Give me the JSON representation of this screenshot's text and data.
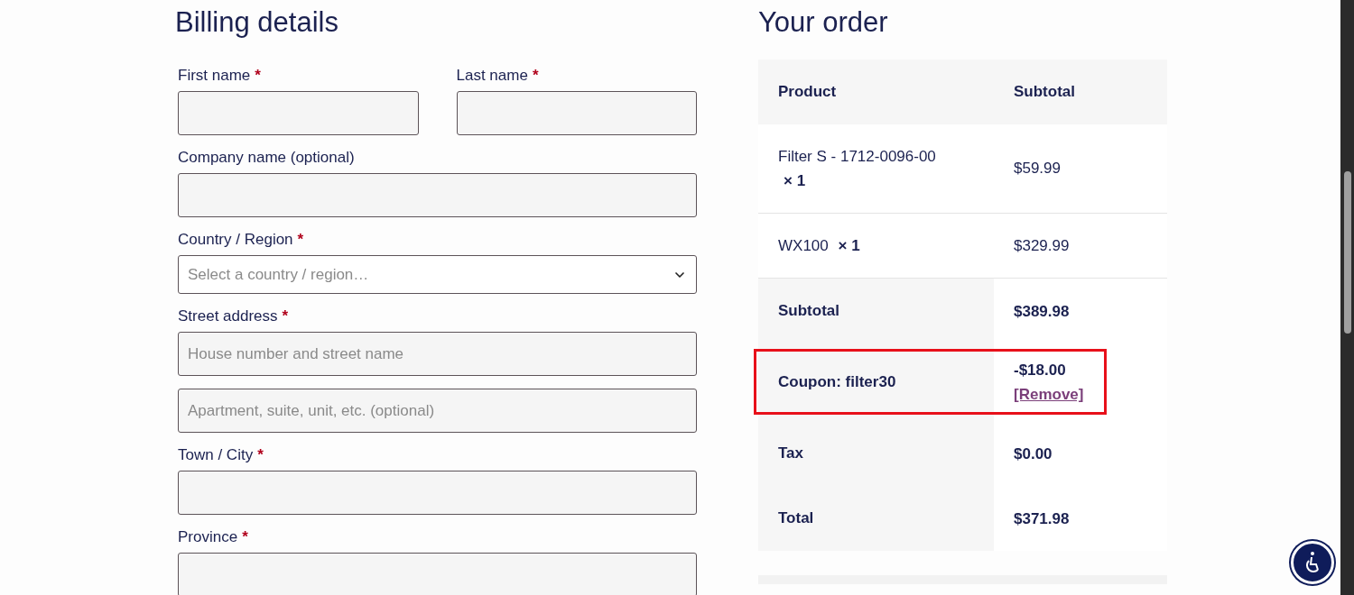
{
  "billing": {
    "title": "Billing details",
    "rows": [
      [
        {
          "label": "First name",
          "required_mark": "*",
          "kind": "input"
        },
        {
          "label": "Last name",
          "required_mark": "*",
          "kind": "input"
        }
      ],
      [
        {
          "label": "Company name (optional)",
          "kind": "input"
        }
      ],
      [
        {
          "label": "Country / Region",
          "required_mark": "*",
          "kind": "select",
          "placeholder": "Select a country / region…"
        }
      ],
      [
        {
          "label": "Street address",
          "required_mark": "*",
          "kind": "input",
          "placeholder": "House number and street name"
        }
      ],
      [
        {
          "kind": "input",
          "placeholder": "Apartment, suite, unit, etc. (optional)"
        }
      ],
      [
        {
          "label": "Town / City",
          "required_mark": "*",
          "kind": "input"
        }
      ],
      [
        {
          "label": "Province",
          "required_mark": "*",
          "kind": "input"
        }
      ]
    ]
  },
  "order": {
    "title": "Your order",
    "columns": [
      "Product",
      "Subtotal"
    ],
    "items": [
      {
        "name": "Filter S - 1712-0096-00",
        "qty": "× 1",
        "subtotal": "$59.99"
      },
      {
        "name": "WX100",
        "qty": "× 1",
        "subtotal": "$329.99"
      }
    ],
    "totals": [
      {
        "label": "Subtotal",
        "value": "$389.98",
        "highlighted": false
      },
      {
        "label": "Coupon: filter30",
        "value": "-$18.00",
        "link": "[Remove]",
        "highlighted": true
      },
      {
        "label": "Tax",
        "value": "$0.00",
        "highlighted": false
      },
      {
        "label": "Total",
        "value": "$371.98",
        "highlighted": false
      }
    ]
  }
}
